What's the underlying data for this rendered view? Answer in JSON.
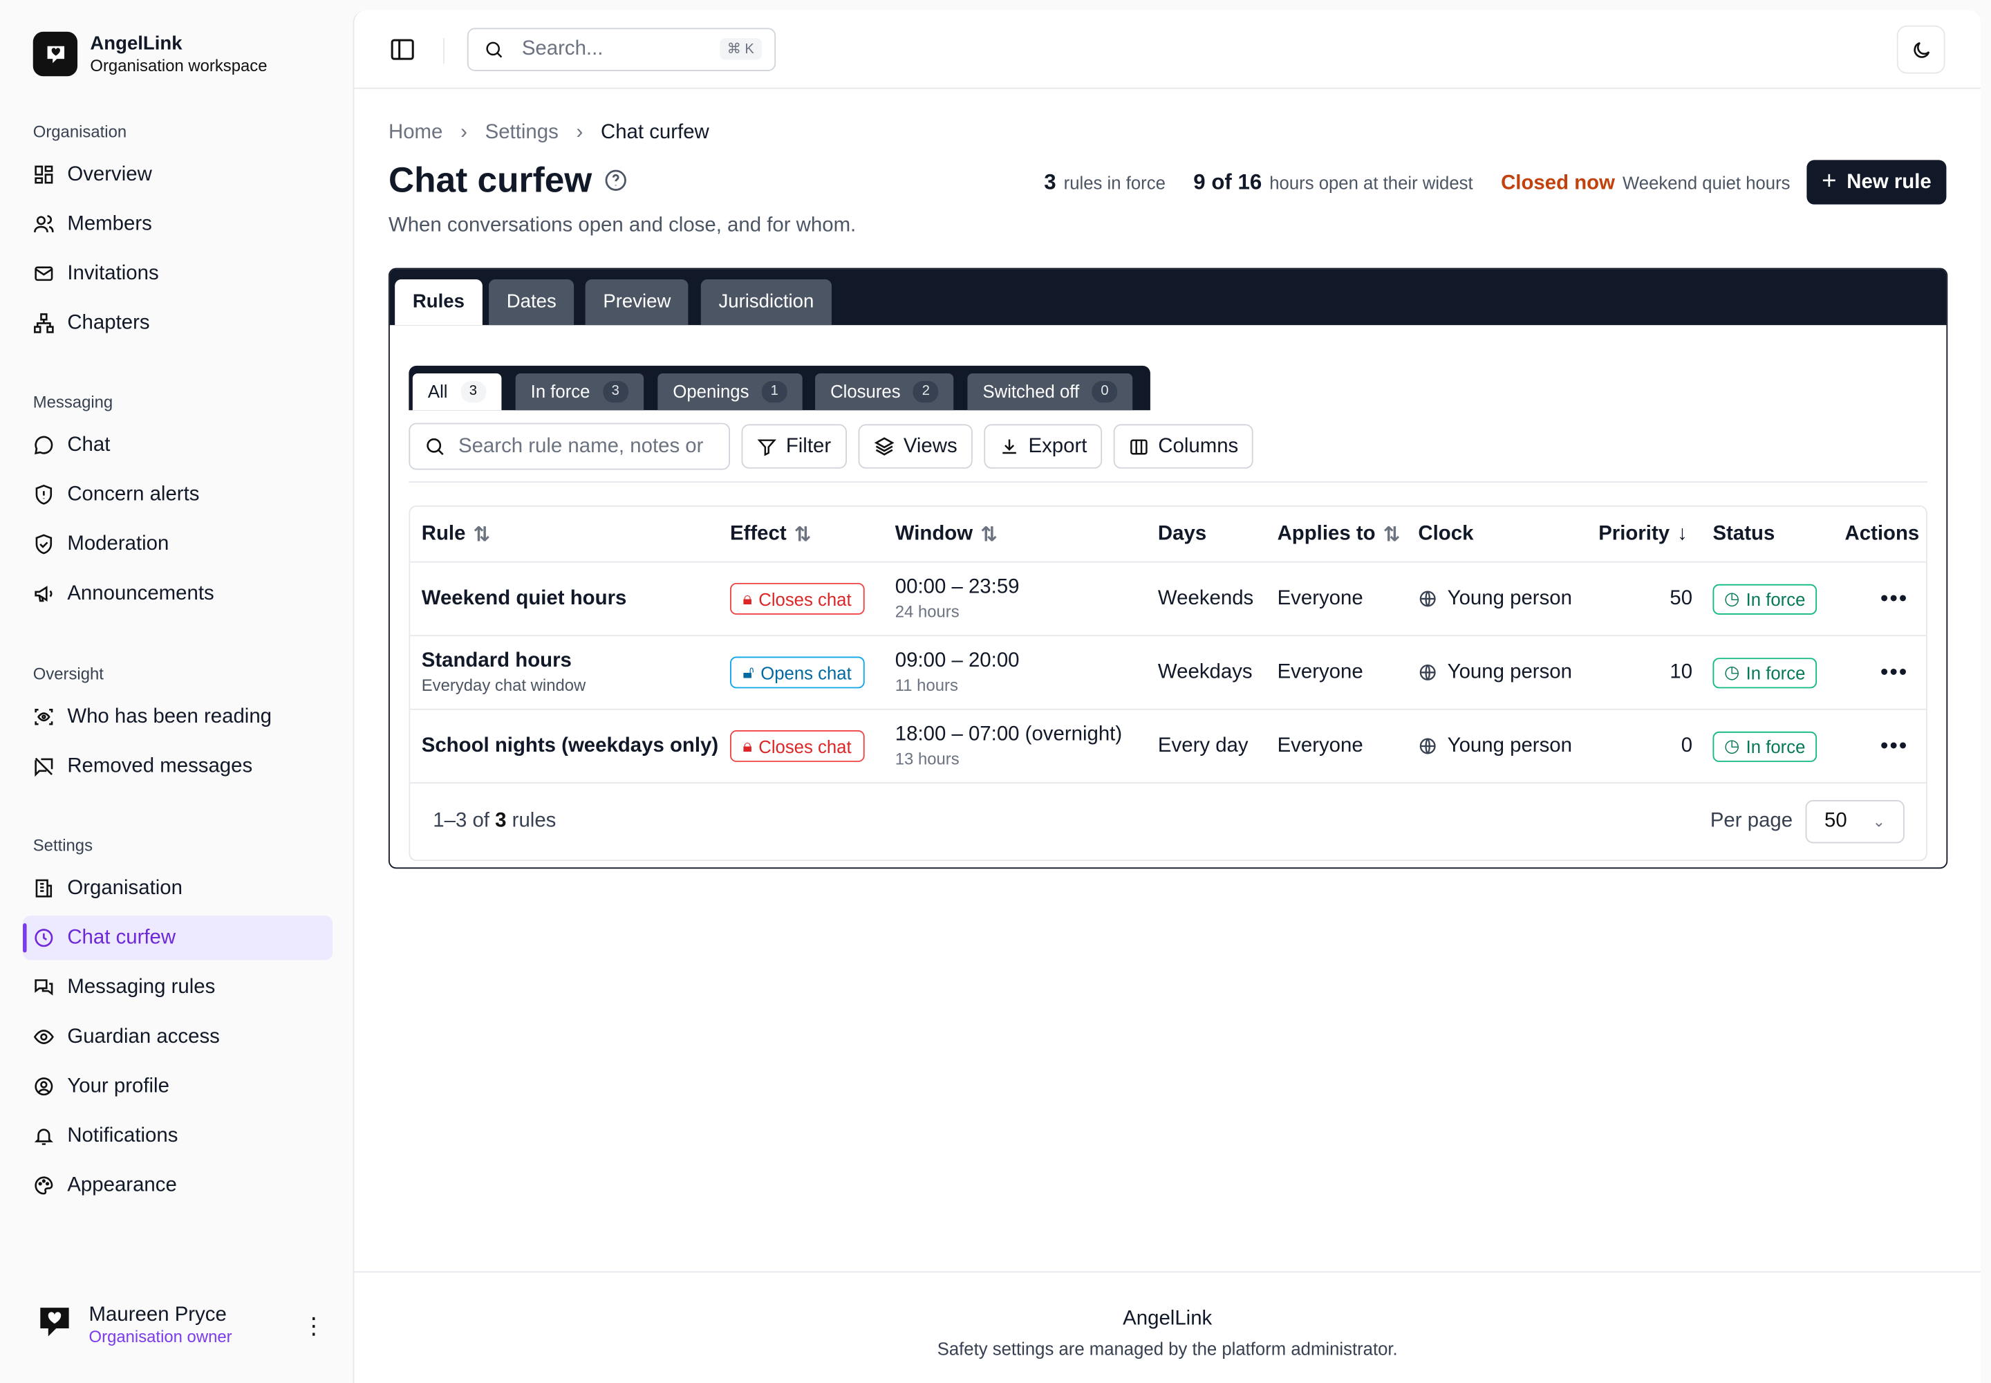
{
  "brand": {
    "name": "AngelLink",
    "subtitle": "Organisation workspace"
  },
  "sidebar": {
    "sections": [
      {
        "title": "Organisation",
        "items": [
          {
            "label": "Overview",
            "icon": "dashboard-icon"
          },
          {
            "label": "Members",
            "icon": "users-icon"
          },
          {
            "label": "Invitations",
            "icon": "mail-icon"
          },
          {
            "label": "Chapters",
            "icon": "network-icon"
          }
        ]
      },
      {
        "title": "Messaging",
        "items": [
          {
            "label": "Chat",
            "icon": "chat-bubble-icon"
          },
          {
            "label": "Concern alerts",
            "icon": "shield-alert-icon"
          },
          {
            "label": "Moderation",
            "icon": "shield-check-icon"
          },
          {
            "label": "Announcements",
            "icon": "megaphone-icon"
          }
        ]
      },
      {
        "title": "Oversight",
        "items": [
          {
            "label": "Who has been reading",
            "icon": "scan-eye-icon"
          },
          {
            "label": "Removed messages",
            "icon": "message-off-icon"
          }
        ]
      },
      {
        "title": "Settings",
        "items": [
          {
            "label": "Organisation",
            "icon": "building-icon"
          },
          {
            "label": "Chat curfew",
            "icon": "clock-icon",
            "active": true
          },
          {
            "label": "Messaging rules",
            "icon": "messages-icon"
          },
          {
            "label": "Guardian access",
            "icon": "eye-icon"
          },
          {
            "label": "Your profile",
            "icon": "user-circle-icon"
          },
          {
            "label": "Notifications",
            "icon": "bell-icon"
          },
          {
            "label": "Appearance",
            "icon": "palette-icon"
          }
        ]
      }
    ],
    "user": {
      "name": "Maureen Pryce",
      "role": "Organisation owner"
    }
  },
  "topbar": {
    "search_placeholder": "Search...",
    "shortcut": "⌘ K"
  },
  "breadcrumb": [
    "Home",
    "Settings",
    "Chat curfew"
  ],
  "page": {
    "title": "Chat curfew",
    "description": "When conversations open and close, and for whom.",
    "stats": {
      "rules_count": "3",
      "rules_label": "rules in force",
      "hours_value": "9 of 16",
      "hours_label": "hours open at their widest",
      "closed_now": "Closed now",
      "closed_rule": "Weekend quiet hours"
    },
    "new_button": "New rule"
  },
  "card_tabs": [
    "Rules",
    "Dates",
    "Preview",
    "Jurisdiction"
  ],
  "filter_tabs": [
    {
      "label": "All",
      "count": "3"
    },
    {
      "label": "In force",
      "count": "3"
    },
    {
      "label": "Openings",
      "count": "1"
    },
    {
      "label": "Closures",
      "count": "2"
    },
    {
      "label": "Switched off",
      "count": "0"
    }
  ],
  "toolbar": {
    "search_placeholder": "Search rule name, notes or",
    "filter": "Filter",
    "views": "Views",
    "export": "Export",
    "columns": "Columns"
  },
  "table": {
    "headers": {
      "rule": "Rule",
      "effect": "Effect",
      "window": "Window",
      "days": "Days",
      "applies": "Applies to",
      "clock": "Clock",
      "priority": "Priority",
      "status": "Status",
      "actions": "Actions"
    },
    "rows": [
      {
        "name": "Weekend quiet hours",
        "sub": "",
        "effect": "Closes chat",
        "effect_type": "close",
        "window": "00:00 – 23:59",
        "window_sub": "24 hours",
        "days": "Weekends",
        "applies": "Everyone",
        "clock": "Young person",
        "priority": "50",
        "status": "In force"
      },
      {
        "name": "Standard hours",
        "sub": "Everyday chat window",
        "effect": "Opens chat",
        "effect_type": "open",
        "window": "09:00 – 20:00",
        "window_sub": "11 hours",
        "days": "Weekdays",
        "applies": "Everyone",
        "clock": "Young person",
        "priority": "10",
        "status": "In force"
      },
      {
        "name": "School nights (weekdays only)",
        "sub": "",
        "effect": "Closes chat",
        "effect_type": "close",
        "window": "18:00 – 07:00 (overnight)",
        "window_sub": "13 hours",
        "days": "Every day",
        "applies": "Everyone",
        "clock": "Young person",
        "priority": "0",
        "status": "In force"
      }
    ],
    "footer": {
      "range": "1–3 of",
      "total": "3",
      "unit": "rules",
      "per_page_label": "Per page",
      "per_page": "50"
    }
  },
  "footer": {
    "title": "AngelLink",
    "note": "Safety settings are managed by the platform administrator."
  },
  "colors": {
    "accent": "#7c3aed",
    "dark": "#111827",
    "danger": "#dc2626",
    "info": "#0369a1",
    "success": "#047857",
    "warning": "#c2410c"
  }
}
